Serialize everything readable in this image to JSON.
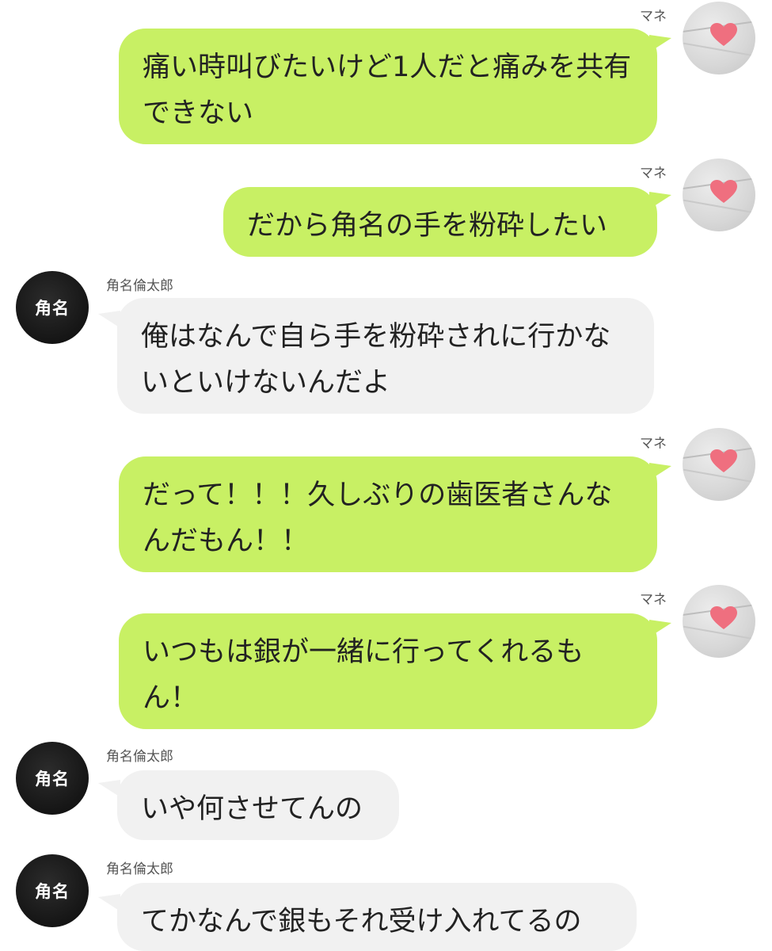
{
  "colors": {
    "my_bubble": "#c8f064",
    "their_bubble": "#f1f1f1",
    "their_avatar": "#141414"
  },
  "messages": [
    {
      "sender": "mine",
      "name": "マネ",
      "text": "痛い時叫びたいけど1人だと痛みを共有できない",
      "avatar_icon": "heart-icon"
    },
    {
      "sender": "mine",
      "name": "マネ",
      "text": "だから角名の手を粉砕したい",
      "avatar_icon": "heart-icon"
    },
    {
      "sender": "theirs",
      "name": "角名倫太郎",
      "text": "俺はなんで自ら手を粉砕されに行かないといけないんだよ",
      "avatar_label": "角名"
    },
    {
      "sender": "mine",
      "name": "マネ",
      "text": "だって！！！久しぶりの歯医者さんなんだもん！！",
      "avatar_icon": "heart-icon"
    },
    {
      "sender": "mine",
      "name": "マネ",
      "text": "いつもは銀が一緒に行ってくれるもん！",
      "avatar_icon": "heart-icon"
    },
    {
      "sender": "theirs",
      "name": "角名倫太郎",
      "text": "いや何させてんの",
      "avatar_label": "角名"
    },
    {
      "sender": "theirs",
      "name": "角名倫太郎",
      "text": "てかなんで銀もそれ受け入れてるの",
      "avatar_label": "角名"
    }
  ]
}
